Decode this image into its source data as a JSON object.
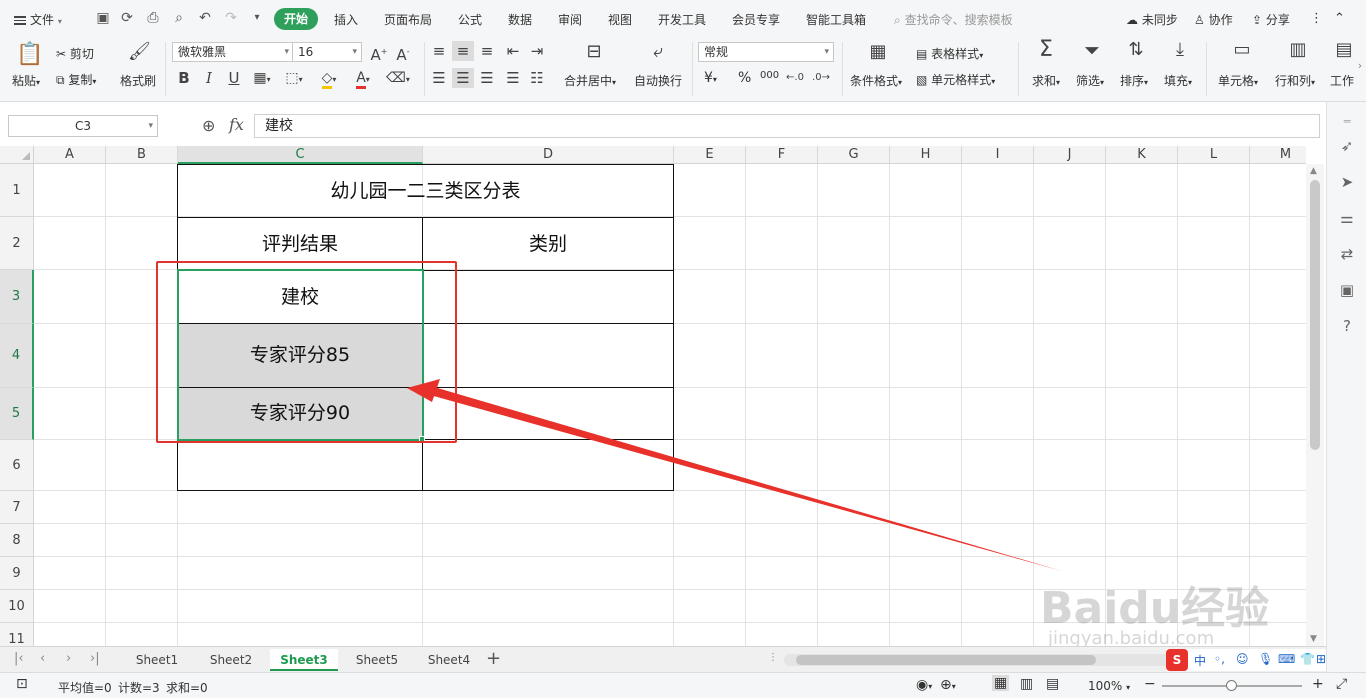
{
  "menubar": {
    "file": "文件",
    "tabs": [
      "开始",
      "插入",
      "页面布局",
      "公式",
      "数据",
      "审阅",
      "视图",
      "开发工具",
      "会员专享",
      "智能工具箱"
    ],
    "search_placeholder": "查找命令、搜索模板",
    "sync": "未同步",
    "collab": "协作",
    "share": "分享"
  },
  "ribbon": {
    "paste": "粘贴",
    "cut": "剪切",
    "copy": "复制",
    "format_painter": "格式刷",
    "font_name": "微软雅黑",
    "font_size": "16",
    "bold": "B",
    "italic": "I",
    "underline": "U",
    "merge_center": "合并居中",
    "wrap_text": "自动换行",
    "number_format": "常规",
    "currency": "¥",
    "percent": "%",
    "thousands": "000",
    "cond_format": "条件格式",
    "table_style": "表格样式",
    "cell_style": "单元格样式",
    "sum": "求和",
    "filter": "筛选",
    "sort": "排序",
    "fill": "填充",
    "cells": "单元格",
    "row_col": "行和列",
    "worksheet": "工作"
  },
  "formula_bar": {
    "cell_ref": "C3",
    "fx": "fx",
    "content": "建校"
  },
  "grid": {
    "columns": [
      "A",
      "B",
      "C",
      "D",
      "E",
      "F",
      "G",
      "H",
      "I",
      "J",
      "K",
      "L",
      "M"
    ],
    "rows": [
      "1",
      "2",
      "3",
      "4",
      "5",
      "6",
      "7",
      "8",
      "9",
      "10",
      "11"
    ],
    "cells": {
      "title": "幼儿园一二三类区分表",
      "c2": "评判结果",
      "d2": "类别",
      "c3": "建校",
      "c4": "专家评分85",
      "c5": "专家评分90"
    }
  },
  "sheets": [
    "Sheet1",
    "Sheet2",
    "Sheet3",
    "Sheet5",
    "Sheet4"
  ],
  "active_sheet": "Sheet3",
  "status": {
    "average": "平均值=0",
    "count": "计数=3",
    "sum": "求和=0",
    "zoom": "100%"
  },
  "watermark": {
    "brand": "Baidu经验",
    "url": "jingyan.baidu.com"
  },
  "colors": {
    "accent_green": "#2aa060",
    "annotation_red": "#e0342c",
    "selection_fill": "#d9d9d9"
  }
}
